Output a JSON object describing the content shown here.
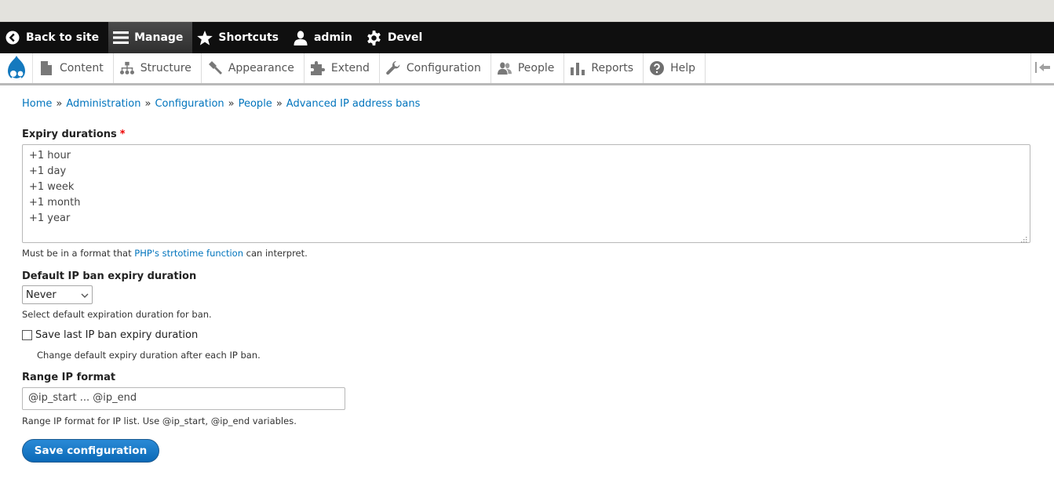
{
  "toolbar": {
    "items": [
      {
        "label": "Back to site",
        "icon": "back-circle-icon"
      },
      {
        "label": "Manage",
        "icon": "menu-icon"
      },
      {
        "label": "Shortcuts",
        "icon": "star-icon"
      },
      {
        "label": "admin",
        "icon": "user-icon"
      },
      {
        "label": "Devel",
        "icon": "gear-icon"
      }
    ]
  },
  "tray": {
    "items": [
      {
        "label": "Content",
        "icon": "file-icon"
      },
      {
        "label": "Structure",
        "icon": "sitemap-icon"
      },
      {
        "label": "Appearance",
        "icon": "brush-icon"
      },
      {
        "label": "Extend",
        "icon": "puzzle-icon"
      },
      {
        "label": "Configuration",
        "icon": "wrench-icon"
      },
      {
        "label": "People",
        "icon": "people-icon"
      },
      {
        "label": "Reports",
        "icon": "bar-chart-icon"
      },
      {
        "label": "Help",
        "icon": "help-icon"
      }
    ]
  },
  "breadcrumb": {
    "items": [
      "Home",
      "Administration",
      "Configuration",
      "People",
      "Advanced IP address bans"
    ],
    "separator": "»"
  },
  "form": {
    "expiry": {
      "label": "Expiry durations",
      "required_marker": "*",
      "lines": [
        "+1 hour",
        "+1 day",
        "+1 week",
        "+1 month",
        "+1 year"
      ],
      "desc_before": "Must be in a format that ",
      "desc_link": "PHP's strtotime function",
      "desc_after": " can interpret."
    },
    "default_duration": {
      "label": "Default IP ban expiry duration",
      "selected": "Never",
      "desc": "Select default expiration duration for ban."
    },
    "save_last": {
      "label": "Save last IP ban expiry duration",
      "checked": false,
      "desc": "Change default expiry duration after each IP ban."
    },
    "range_format": {
      "label": "Range IP format",
      "value": "@ip_start ... @ip_end",
      "desc": "Range IP format for IP list. Use @ip_start, @ip_end variables."
    },
    "submit_label": "Save configuration"
  },
  "colors": {
    "toolbar_bg": "#0f0f0f",
    "link": "#0074bd",
    "primary_button": "#1a7bc9",
    "required": "#e00000"
  }
}
